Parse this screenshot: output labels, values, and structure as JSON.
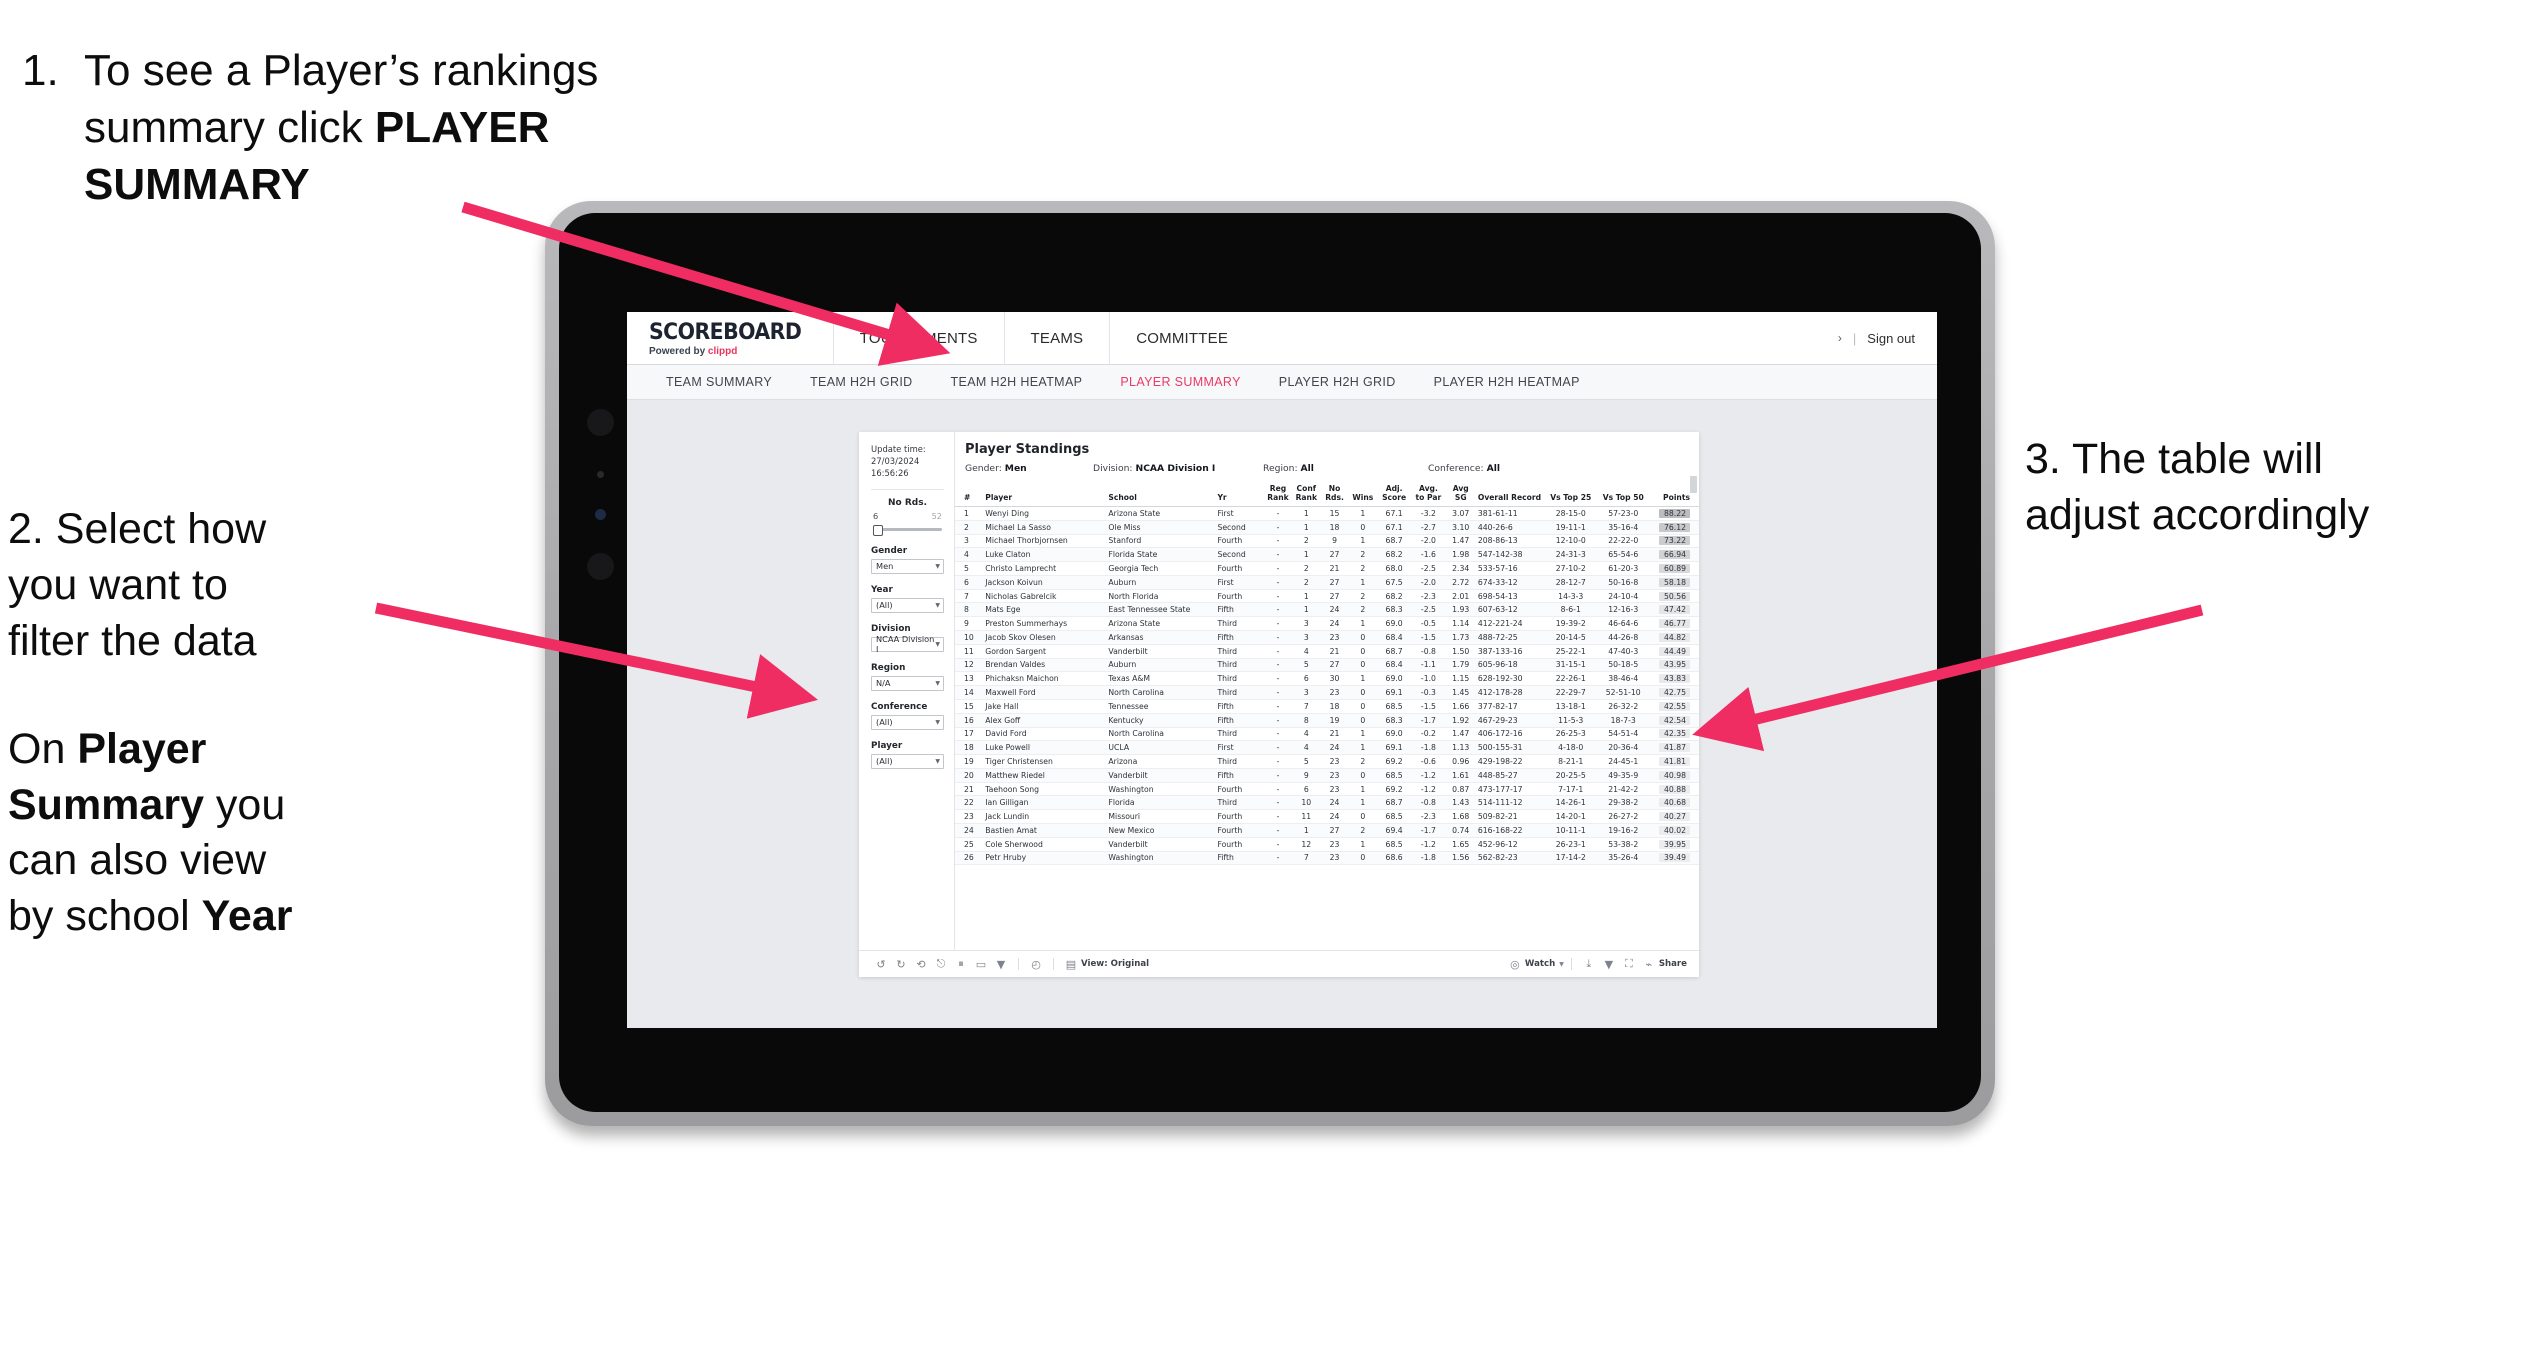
{
  "annotations": {
    "one": {
      "number": "1.",
      "line1": "To see a Player’s rankings",
      "line2_pre": "summary click ",
      "line2_bold": "PLAYER",
      "line3_bold": "SUMMARY"
    },
    "two": {
      "line1": "2. Select how",
      "line2": "you want to",
      "line3": "filter the data",
      "p2_pre": "On ",
      "p2_b1": "Player",
      "p2_b2": "Summary",
      "p2_mid": " you",
      "p2_l3": "can also view",
      "p2_l4_pre": "by school ",
      "p2_l4_bold": "Year"
    },
    "three": {
      "line1": "3. The table will",
      "line2": "adjust accordingly"
    }
  },
  "colors": {
    "accent": "#ea3a66",
    "arrow": "#ef2d62",
    "brand_pink": "#e8355f"
  },
  "app": {
    "brand": {
      "logo": "SCOREBOARD",
      "powered_pre": "Powered by ",
      "powered_brand": "clippd"
    },
    "topnav": [
      {
        "label": "TOURNAMENTS",
        "name": "nav-tournaments"
      },
      {
        "label": "TEAMS",
        "name": "nav-teams"
      },
      {
        "label": "COMMITTEE",
        "name": "nav-committee"
      }
    ],
    "account": {
      "chevron": "›",
      "separator": "|",
      "signout": "Sign out"
    },
    "subnav": [
      {
        "label": "TEAM SUMMARY",
        "active": false
      },
      {
        "label": "TEAM H2H GRID",
        "active": false
      },
      {
        "label": "TEAM H2H HEATMAP",
        "active": false
      },
      {
        "label": "PLAYER SUMMARY",
        "active": true
      },
      {
        "label": "PLAYER H2H GRID",
        "active": false
      },
      {
        "label": "PLAYER H2H HEATMAP",
        "active": false
      }
    ]
  },
  "filters": {
    "update_label": "Update time:",
    "update_value": "27/03/2024 16:56:26",
    "slider": {
      "label": "No Rds.",
      "min": "6",
      "max": "52"
    },
    "selects": [
      {
        "label": "Gender",
        "value": "Men"
      },
      {
        "label": "Year",
        "value": "(All)"
      },
      {
        "label": "Division",
        "value": "NCAA Division I"
      },
      {
        "label": "Region",
        "value": "N/A"
      },
      {
        "label": "Conference",
        "value": "(All)"
      },
      {
        "label": "Player",
        "value": "(All)"
      }
    ]
  },
  "dashboard": {
    "title": "Player Standings",
    "meta": [
      {
        "label": "Gender:",
        "value": "Men"
      },
      {
        "label": "Division:",
        "value": "NCAA Division I"
      },
      {
        "label": "Region:",
        "value": "All"
      },
      {
        "label": "Conference:",
        "value": "All"
      }
    ]
  },
  "table": {
    "headers": [
      "#",
      "Player",
      "School",
      "Yr",
      "Reg Rank",
      "Conf Rank",
      "No Rds.",
      "Wins",
      "Adj. Score",
      "Avg. to Par",
      "Avg SG",
      "Overall Record",
      "Vs Top 25",
      "Vs Top 50",
      "Points"
    ],
    "rows": [
      {
        "n": "1",
        "player": "Wenyi Ding",
        "school": "Arizona State",
        "yr": "First",
        "reg": "-",
        "conf": "1",
        "rds": "15",
        "wins": "1",
        "adj": "67.1",
        "par": "-3.2",
        "sg": "3.07",
        "rec": "381-61-11",
        "t25": "28-15-0",
        "t50": "57-23-0",
        "pts": "88.22"
      },
      {
        "n": "2",
        "player": "Michael La Sasso",
        "school": "Ole Miss",
        "yr": "Second",
        "reg": "-",
        "conf": "1",
        "rds": "18",
        "wins": "0",
        "adj": "67.1",
        "par": "-2.7",
        "sg": "3.10",
        "rec": "440-26-6",
        "t25": "19-11-1",
        "t50": "35-16-4",
        "pts": "76.12"
      },
      {
        "n": "3",
        "player": "Michael Thorbjornsen",
        "school": "Stanford",
        "yr": "Fourth",
        "reg": "-",
        "conf": "2",
        "rds": "9",
        "wins": "1",
        "adj": "68.7",
        "par": "-2.0",
        "sg": "1.47",
        "rec": "208-86-13",
        "t25": "12-10-0",
        "t50": "22-22-0",
        "pts": "73.22"
      },
      {
        "n": "4",
        "player": "Luke Claton",
        "school": "Florida State",
        "yr": "Second",
        "reg": "-",
        "conf": "1",
        "rds": "27",
        "wins": "2",
        "adj": "68.2",
        "par": "-1.6",
        "sg": "1.98",
        "rec": "547-142-38",
        "t25": "24-31-3",
        "t50": "65-54-6",
        "pts": "66.94"
      },
      {
        "n": "5",
        "player": "Christo Lamprecht",
        "school": "Georgia Tech",
        "yr": "Fourth",
        "reg": "-",
        "conf": "2",
        "rds": "21",
        "wins": "2",
        "adj": "68.0",
        "par": "-2.5",
        "sg": "2.34",
        "rec": "533-57-16",
        "t25": "27-10-2",
        "t50": "61-20-3",
        "pts": "60.89"
      },
      {
        "n": "6",
        "player": "Jackson Koivun",
        "school": "Auburn",
        "yr": "First",
        "reg": "-",
        "conf": "2",
        "rds": "27",
        "wins": "1",
        "adj": "67.5",
        "par": "-2.0",
        "sg": "2.72",
        "rec": "674-33-12",
        "t25": "28-12-7",
        "t50": "50-16-8",
        "pts": "58.18"
      },
      {
        "n": "7",
        "player": "Nicholas Gabrelcik",
        "school": "North Florida",
        "yr": "Fourth",
        "reg": "-",
        "conf": "1",
        "rds": "27",
        "wins": "2",
        "adj": "68.2",
        "par": "-2.3",
        "sg": "2.01",
        "rec": "698-54-13",
        "t25": "14-3-3",
        "t50": "24-10-4",
        "pts": "50.56"
      },
      {
        "n": "8",
        "player": "Mats Ege",
        "school": "East Tennessee State",
        "yr": "Fifth",
        "reg": "-",
        "conf": "1",
        "rds": "24",
        "wins": "2",
        "adj": "68.3",
        "par": "-2.5",
        "sg": "1.93",
        "rec": "607-63-12",
        "t25": "8-6-1",
        "t50": "12-16-3",
        "pts": "47.42"
      },
      {
        "n": "9",
        "player": "Preston Summerhays",
        "school": "Arizona State",
        "yr": "Third",
        "reg": "-",
        "conf": "3",
        "rds": "24",
        "wins": "1",
        "adj": "69.0",
        "par": "-0.5",
        "sg": "1.14",
        "rec": "412-221-24",
        "t25": "19-39-2",
        "t50": "46-64-6",
        "pts": "46.77"
      },
      {
        "n": "10",
        "player": "Jacob Skov Olesen",
        "school": "Arkansas",
        "yr": "Fifth",
        "reg": "-",
        "conf": "3",
        "rds": "23",
        "wins": "0",
        "adj": "68.4",
        "par": "-1.5",
        "sg": "1.73",
        "rec": "488-72-25",
        "t25": "20-14-5",
        "t50": "44-26-8",
        "pts": "44.82"
      },
      {
        "n": "11",
        "player": "Gordon Sargent",
        "school": "Vanderbilt",
        "yr": "Third",
        "reg": "-",
        "conf": "4",
        "rds": "21",
        "wins": "0",
        "adj": "68.7",
        "par": "-0.8",
        "sg": "1.50",
        "rec": "387-133-16",
        "t25": "25-22-1",
        "t50": "47-40-3",
        "pts": "44.49"
      },
      {
        "n": "12",
        "player": "Brendan Valdes",
        "school": "Auburn",
        "yr": "Third",
        "reg": "-",
        "conf": "5",
        "rds": "27",
        "wins": "0",
        "adj": "68.4",
        "par": "-1.1",
        "sg": "1.79",
        "rec": "605-96-18",
        "t25": "31-15-1",
        "t50": "50-18-5",
        "pts": "43.95"
      },
      {
        "n": "13",
        "player": "Phichaksn Maichon",
        "school": "Texas A&M",
        "yr": "Third",
        "reg": "-",
        "conf": "6",
        "rds": "30",
        "wins": "1",
        "adj": "69.0",
        "par": "-1.0",
        "sg": "1.15",
        "rec": "628-192-30",
        "t25": "22-26-1",
        "t50": "38-46-4",
        "pts": "43.83"
      },
      {
        "n": "14",
        "player": "Maxwell Ford",
        "school": "North Carolina",
        "yr": "Third",
        "reg": "-",
        "conf": "3",
        "rds": "23",
        "wins": "0",
        "adj": "69.1",
        "par": "-0.3",
        "sg": "1.45",
        "rec": "412-178-28",
        "t25": "22-29-7",
        "t50": "52-51-10",
        "pts": "42.75"
      },
      {
        "n": "15",
        "player": "Jake Hall",
        "school": "Tennessee",
        "yr": "Fifth",
        "reg": "-",
        "conf": "7",
        "rds": "18",
        "wins": "0",
        "adj": "68.5",
        "par": "-1.5",
        "sg": "1.66",
        "rec": "377-82-17",
        "t25": "13-18-1",
        "t50": "26-32-2",
        "pts": "42.55"
      },
      {
        "n": "16",
        "player": "Alex Goff",
        "school": "Kentucky",
        "yr": "Fifth",
        "reg": "-",
        "conf": "8",
        "rds": "19",
        "wins": "0",
        "adj": "68.3",
        "par": "-1.7",
        "sg": "1.92",
        "rec": "467-29-23",
        "t25": "11-5-3",
        "t50": "18-7-3",
        "pts": "42.54"
      },
      {
        "n": "17",
        "player": "David Ford",
        "school": "North Carolina",
        "yr": "Third",
        "reg": "-",
        "conf": "4",
        "rds": "21",
        "wins": "1",
        "adj": "69.0",
        "par": "-0.2",
        "sg": "1.47",
        "rec": "406-172-16",
        "t25": "26-25-3",
        "t50": "54-51-4",
        "pts": "42.35"
      },
      {
        "n": "18",
        "player": "Luke Powell",
        "school": "UCLA",
        "yr": "First",
        "reg": "-",
        "conf": "4",
        "rds": "24",
        "wins": "1",
        "adj": "69.1",
        "par": "-1.8",
        "sg": "1.13",
        "rec": "500-155-31",
        "t25": "4-18-0",
        "t50": "20-36-4",
        "pts": "41.87"
      },
      {
        "n": "19",
        "player": "Tiger Christensen",
        "school": "Arizona",
        "yr": "Third",
        "reg": "-",
        "conf": "5",
        "rds": "23",
        "wins": "2",
        "adj": "69.2",
        "par": "-0.6",
        "sg": "0.96",
        "rec": "429-198-22",
        "t25": "8-21-1",
        "t50": "24-45-1",
        "pts": "41.81"
      },
      {
        "n": "20",
        "player": "Matthew Riedel",
        "school": "Vanderbilt",
        "yr": "Fifth",
        "reg": "-",
        "conf": "9",
        "rds": "23",
        "wins": "0",
        "adj": "68.5",
        "par": "-1.2",
        "sg": "1.61",
        "rec": "448-85-27",
        "t25": "20-25-5",
        "t50": "49-35-9",
        "pts": "40.98"
      },
      {
        "n": "21",
        "player": "Taehoon Song",
        "school": "Washington",
        "yr": "Fourth",
        "reg": "-",
        "conf": "6",
        "rds": "23",
        "wins": "1",
        "adj": "69.2",
        "par": "-1.2",
        "sg": "0.87",
        "rec": "473-177-17",
        "t25": "7-17-1",
        "t50": "21-42-2",
        "pts": "40.88"
      },
      {
        "n": "22",
        "player": "Ian Gilligan",
        "school": "Florida",
        "yr": "Third",
        "reg": "-",
        "conf": "10",
        "rds": "24",
        "wins": "1",
        "adj": "68.7",
        "par": "-0.8",
        "sg": "1.43",
        "rec": "514-111-12",
        "t25": "14-26-1",
        "t50": "29-38-2",
        "pts": "40.68"
      },
      {
        "n": "23",
        "player": "Jack Lundin",
        "school": "Missouri",
        "yr": "Fourth",
        "reg": "-",
        "conf": "11",
        "rds": "24",
        "wins": "0",
        "adj": "68.5",
        "par": "-2.3",
        "sg": "1.68",
        "rec": "509-82-21",
        "t25": "14-20-1",
        "t50": "26-27-2",
        "pts": "40.27"
      },
      {
        "n": "24",
        "player": "Bastien Amat",
        "school": "New Mexico",
        "yr": "Fourth",
        "reg": "-",
        "conf": "1",
        "rds": "27",
        "wins": "2",
        "adj": "69.4",
        "par": "-1.7",
        "sg": "0.74",
        "rec": "616-168-22",
        "t25": "10-11-1",
        "t50": "19-16-2",
        "pts": "40.02"
      },
      {
        "n": "25",
        "player": "Cole Sherwood",
        "school": "Vanderbilt",
        "yr": "Fourth",
        "reg": "-",
        "conf": "12",
        "rds": "23",
        "wins": "1",
        "adj": "68.5",
        "par": "-1.2",
        "sg": "1.65",
        "rec": "452-96-12",
        "t25": "26-23-1",
        "t50": "53-38-2",
        "pts": "39.95"
      },
      {
        "n": "26",
        "player": "Petr Hruby",
        "school": "Washington",
        "yr": "Fifth",
        "reg": "-",
        "conf": "7",
        "rds": "23",
        "wins": "0",
        "adj": "68.6",
        "par": "-1.8",
        "sg": "1.56",
        "rec": "562-82-23",
        "t25": "17-14-2",
        "t50": "35-26-4",
        "pts": "39.49"
      }
    ]
  },
  "toolbar": {
    "view_label": "View: Original",
    "watch_label": "Watch",
    "share_label": "Share"
  }
}
